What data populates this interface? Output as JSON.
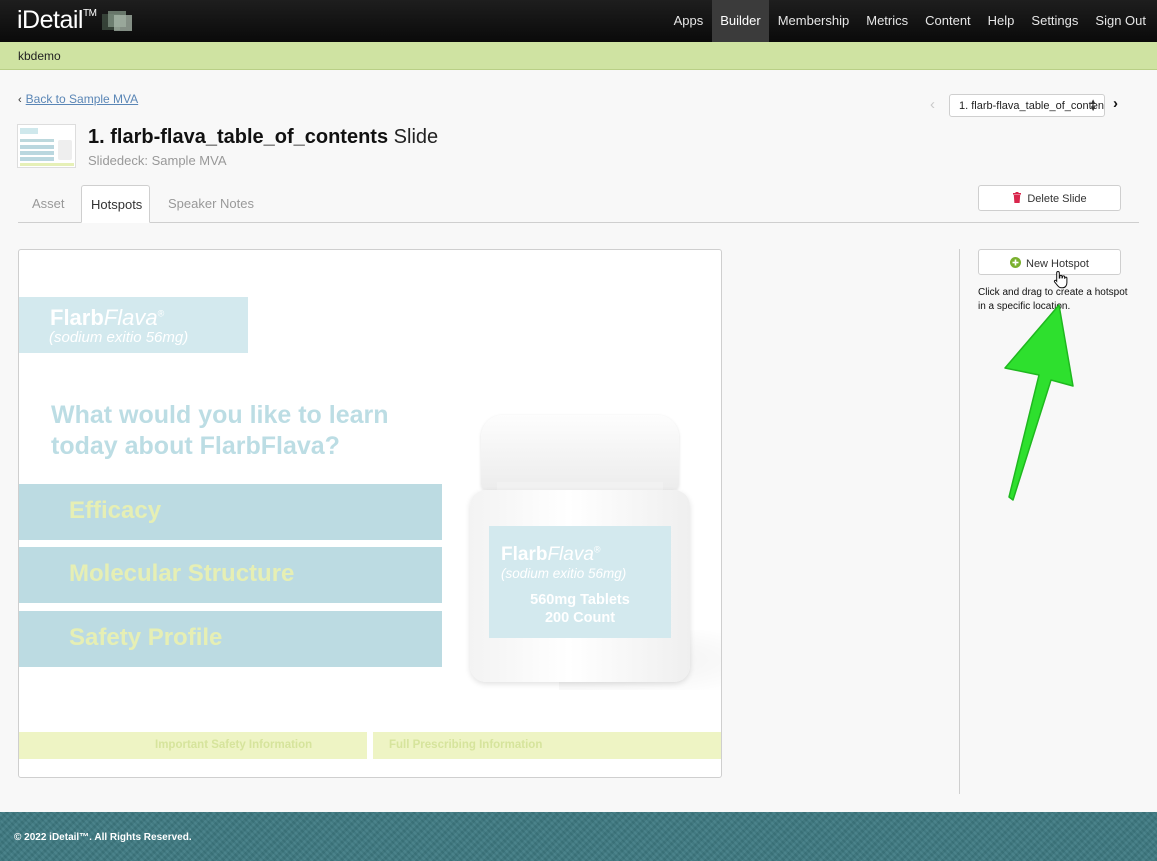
{
  "app": {
    "logo_text": "iDetail",
    "logo_tm": "TM",
    "nav": [
      "Apps",
      "Builder",
      "Membership",
      "Metrics",
      "Content",
      "Help",
      "Settings",
      "Sign Out"
    ],
    "active_nav": "Builder",
    "account": "kbdemo"
  },
  "breadcrumb": {
    "back_label": "Back to Sample MVA"
  },
  "pager": {
    "selected": "1. flarb-flava_table_of_contents"
  },
  "slide_header": {
    "title": "1. flarb-flava_table_of_contents",
    "title_suffix": "Slide",
    "subtitle": "Slidedeck: Sample MVA"
  },
  "tabs": [
    "Asset",
    "Hotspots",
    "Speaker Notes"
  ],
  "active_tab": "Hotspots",
  "buttons": {
    "delete_slide": "Delete Slide",
    "new_hotspot": "New Hotspot"
  },
  "hotspot_help": "Click and drag to create a hotspot in a specific location.",
  "slide": {
    "brand_bold": "Flarb",
    "brand_italic": "Flava",
    "brand_reg": "®",
    "brand_sub": "(sodium exitio 56mg)",
    "question": "What would you like to learn today about FlarbFlava?",
    "menu": [
      "Efficacy",
      "Molecular Structure",
      "Safety Profile"
    ],
    "label_line1": "560mg Tablets",
    "label_line2": "200 Count",
    "footer_links": [
      "Important Safety Information",
      "Full Prescribing Information"
    ]
  },
  "colors": {
    "accent_bar": "#cfe3a2",
    "menu_bg": "#bcdbe2",
    "menu_text": "#e6efb4",
    "arrow": "#2ee02e",
    "footer_bg": "#3e7a82"
  },
  "icons": {
    "back": "chevron-left-icon",
    "prev": "chevron-left-icon",
    "next": "chevron-right-icon",
    "delete": "trash-icon",
    "new": "plus-circle-icon",
    "pointer": "hand-cursor-icon"
  },
  "footer": {
    "copyright": "© 2022 iDetail™.  All Rights Reserved."
  }
}
